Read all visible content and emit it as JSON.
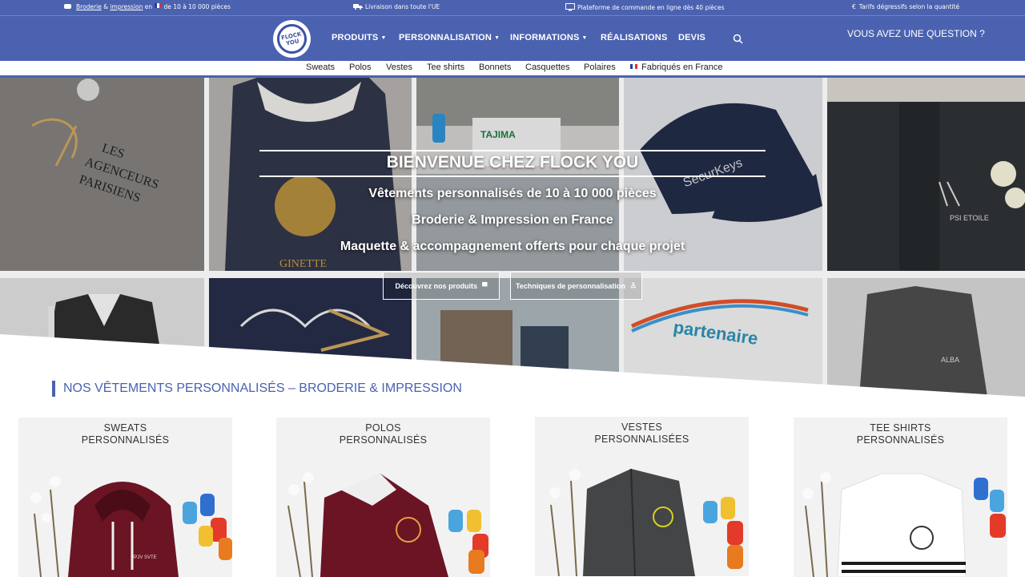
{
  "topbar": {
    "item1_a": "Broderie",
    "item1_amp": "&",
    "item1_b": "impression",
    "item1_c": "en",
    "item1_d": "de 10 à 10 000 pièces",
    "item2": "Livraison dans toute l'UE",
    "item3": "Plateforme de commande en ligne dès 40 pièces",
    "item4": "Tarifs dégressifs selon la quantité"
  },
  "header": {
    "logo_line1": "FLOCK",
    "logo_line2": "YOU",
    "nav": [
      {
        "label": "PRODUITS"
      },
      {
        "label": "PERSONNALISATION"
      },
      {
        "label": "INFORMATIONS"
      },
      {
        "label": "RÉALISATIONS"
      },
      {
        "label": "DEVIS"
      }
    ],
    "question": "VOUS AVEZ UNE QUESTION ?"
  },
  "subnav": [
    "Sweats",
    "Polos",
    "Vestes",
    "Tee shirts",
    "Bonnets",
    "Casquettes",
    "Polaires",
    "Fabriqués en France"
  ],
  "hero": {
    "title": "BIENVENUE CHEZ FLOCK YOU",
    "line1": "Vêtements personnalisés de 10 à 10 000 pièces",
    "line2": "Broderie & Impression en France",
    "line3": "Maquette & accompagnement offerts pour chaque projet",
    "btn1": "Découvrez nos produits",
    "btn2": "Techniques de personnalisation",
    "tile_texts": {
      "t1": "LES AGENCEURS PARISIENS",
      "t2": "GINETTE",
      "t3": "TAJIMA",
      "t4": "SecurKeys",
      "t5": "PSI ETOILE",
      "t6": "partenaire",
      "t7": "ALBA"
    }
  },
  "section": {
    "title": "NOS VÊTEMENTS PERSONNALISÉS – BRODERIE & IMPRESSION"
  },
  "cards": [
    {
      "line1": "SWEATS",
      "line2": "PERSONNALISÉS",
      "print": "UPJV SVTE"
    },
    {
      "line1": "POLOS",
      "line2": "PERSONNALISÉS"
    },
    {
      "line1": "VESTES",
      "line2": "PERSONNALISÉES"
    },
    {
      "line1": "TEE SHIRTS",
      "line2": "PERSONNALISÉS"
    }
  ],
  "colors": {
    "brand_blue": "#4a62b0",
    "maroon": "#6b1424",
    "white": "#ffffff"
  },
  "icons": [
    "flag-fr-icon",
    "truck-icon",
    "monitor-icon",
    "euro-icon",
    "search-icon",
    "caret-down-icon",
    "shirt-icon",
    "badge-icon"
  ]
}
